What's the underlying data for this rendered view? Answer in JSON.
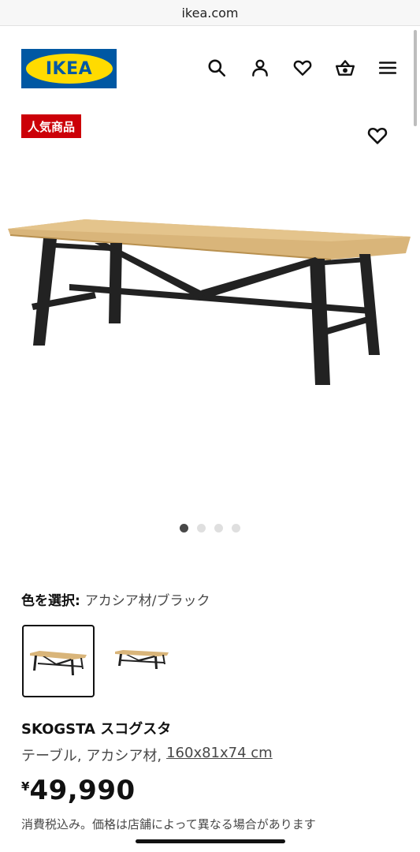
{
  "browser": {
    "url": "ikea.com"
  },
  "header": {
    "logo_text": "IKEA",
    "icons": [
      "search-icon",
      "account-icon",
      "heart-icon",
      "cart-icon",
      "menu-icon"
    ]
  },
  "badge": {
    "label": "人気商品"
  },
  "carousel": {
    "count": 4,
    "active_index": 0
  },
  "color_selection": {
    "label": "色を選択:",
    "value": "アカシア材/ブラック"
  },
  "product": {
    "name": "SKOGSTA スコグスタ",
    "description": "テーブル, アカシア材,",
    "size": "160x81x74 cm",
    "currency": "¥",
    "price": "49,990",
    "tax_note": "消費税込み。価格は店舗によって異なる場合があります"
  },
  "colors": {
    "brand_blue": "#0058a3",
    "brand_yellow": "#ffdb00",
    "badge_red": "#cc0008"
  }
}
